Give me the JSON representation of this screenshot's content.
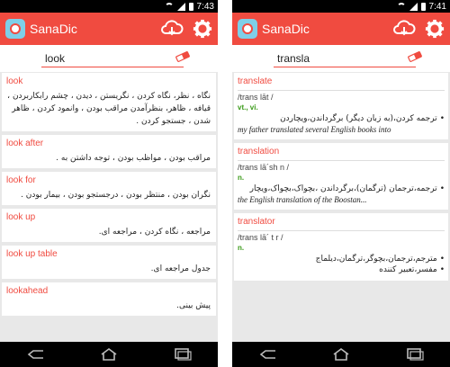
{
  "left": {
    "status": {
      "time": "7:43"
    },
    "app_title": "SanaDic",
    "search": {
      "value": "look"
    },
    "entries": [
      {
        "word": "look",
        "text": "نگاه ، نظر، نگاه کردن ، نگریستن ، دیدن ، چشم رابکاربردن ، قیافه ، ظاهر، بنظرآمدن مراقب بودن ، وانمود کردن ، ظاهر شدن ، جستجو کردن ."
      },
      {
        "word": "look after",
        "text": "مراقب بودن ، مواظب بودن ، توجه داشتن به ."
      },
      {
        "word": "look for",
        "text": "نگران بودن ، منتظر بودن ، درجستجو بودن ، بیمار بودن ."
      },
      {
        "word": "look up",
        "text": "مراجعه ، نگاه کردن ، مراجعه ای."
      },
      {
        "word": "look up table",
        "text": "جدول مراجعه ای."
      },
      {
        "word": "lookahead",
        "text": "پیش بینی."
      }
    ]
  },
  "right": {
    "status": {
      "time": "7:41"
    },
    "app_title": "SanaDic",
    "search": {
      "value": "transla"
    },
    "entries": [
      {
        "word": "translate",
        "phonetic": "/trans lāt /",
        "pos": "vt., vi.",
        "meanings": [
          "ترجمه کردن،(به زبان دیگر) برگرداندن،ویچاردن"
        ],
        "example": "my father translated several English books into"
      },
      {
        "word": "translation",
        "phonetic": "/trans lā´sh n /",
        "pos": "n.",
        "meanings": [
          "ترجمه،ترجمان (ترگمان)،برگرداندن ،بچواک،بچواک،ویچار"
        ],
        "example": "the English translation of the Boostan..."
      },
      {
        "word": "translator",
        "phonetic": "/trans lā´ t r /",
        "pos": "n.",
        "meanings": [
          "مترجم،ترجمان،بچوگر،ترگمان،دیلماج",
          "مفسر،تعبیر کننده"
        ],
        "example": ""
      }
    ]
  },
  "colors": {
    "accent": "#f04b40",
    "pos": "#3a9a18"
  },
  "icons": [
    "cloud-download-icon",
    "gear-icon",
    "eraser-icon",
    "back-icon",
    "home-icon",
    "recents-icon"
  ]
}
